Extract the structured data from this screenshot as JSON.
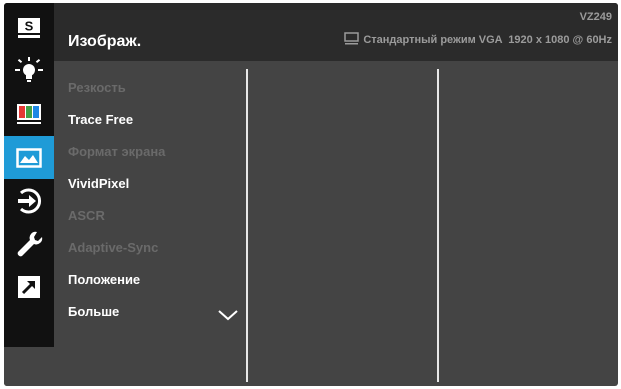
{
  "header": {
    "title": "Изображ.",
    "model": "VZ249",
    "status": "Стандартный режим VGA  1920 x 1080 @ 60Hz"
  },
  "sidebar": {
    "items": [
      {
        "icon": "splendid-s-icon",
        "active": false
      },
      {
        "icon": "brightness-icon",
        "active": false
      },
      {
        "icon": "color-bars-icon",
        "active": false
      },
      {
        "icon": "image-icon",
        "active": true
      },
      {
        "icon": "input-select-icon",
        "active": false
      },
      {
        "icon": "wrench-icon",
        "active": false
      },
      {
        "icon": "shortcut-arrow-icon",
        "active": false
      }
    ]
  },
  "menu": {
    "items": [
      {
        "label": "Резкость",
        "enabled": false
      },
      {
        "label": "Trace Free",
        "enabled": true
      },
      {
        "label": "Формат экрана",
        "enabled": false
      },
      {
        "label": "VividPixel",
        "enabled": true
      },
      {
        "label": "ASCR",
        "enabled": false
      },
      {
        "label": "Adaptive-Sync",
        "enabled": false
      },
      {
        "label": "Положение",
        "enabled": true
      },
      {
        "label": "Больше",
        "enabled": true
      }
    ],
    "more_icon": "chevron-down-icon"
  },
  "colors": {
    "accent": "#1f9bd7",
    "panel": "#444444",
    "header": "#2b2b2b",
    "sidebar": "#111111",
    "text_enabled": "#ffffff",
    "text_disabled": "#6a6a6a"
  }
}
